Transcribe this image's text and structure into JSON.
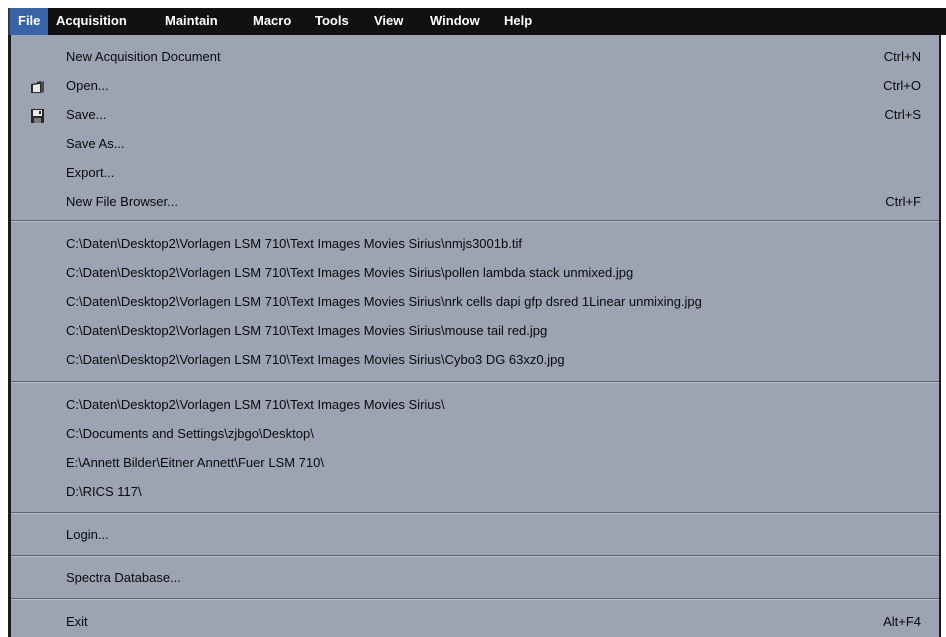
{
  "menubar": {
    "items": [
      {
        "label": "File"
      },
      {
        "label": "Acquisition"
      },
      {
        "label": "Maintain"
      },
      {
        "label": "Macro"
      },
      {
        "label": "Tools"
      },
      {
        "label": "View"
      },
      {
        "label": "Window"
      },
      {
        "label": "Help"
      }
    ]
  },
  "file_menu": {
    "new_acquisition": {
      "label": "New Acquisition Document",
      "shortcut": "Ctrl+N"
    },
    "open": {
      "label": "Open...",
      "shortcut": "Ctrl+O",
      "icon": "open-folder-icon"
    },
    "save": {
      "label": "Save...",
      "shortcut": "Ctrl+S",
      "icon": "floppy-disk-icon"
    },
    "save_as": {
      "label": "Save As..."
    },
    "export": {
      "label": "Export..."
    },
    "new_file_browser": {
      "label": "New File Browser...",
      "shortcut": "Ctrl+F"
    },
    "recent_files": [
      {
        "label": "C:\\Daten\\Desktop2\\Vorlagen LSM 710\\Text Images Movies Sirius\\nmjs3001b.tif"
      },
      {
        "label": "C:\\Daten\\Desktop2\\Vorlagen LSM 710\\Text Images Movies Sirius\\pollen lambda stack unmixed.jpg"
      },
      {
        "label": "C:\\Daten\\Desktop2\\Vorlagen LSM 710\\Text Images Movies Sirius\\nrk cells dapi gfp dsred 1Linear unmixing.jpg"
      },
      {
        "label": "C:\\Daten\\Desktop2\\Vorlagen LSM 710\\Text Images Movies Sirius\\mouse tail red.jpg"
      },
      {
        "label": "C:\\Daten\\Desktop2\\Vorlagen LSM 710\\Text Images Movies Sirius\\Cybo3 DG 63xz0.jpg"
      }
    ],
    "recent_folders": [
      {
        "label": "C:\\Daten\\Desktop2\\Vorlagen LSM 710\\Text Images Movies Sirius\\"
      },
      {
        "label": "C:\\Documents and Settings\\zjbgo\\Desktop\\"
      },
      {
        "label": "E:\\Annett Bilder\\Eitner Annett\\Fuer LSM 710\\"
      },
      {
        "label": "D:\\RICS 117\\"
      }
    ],
    "login": {
      "label": "Login..."
    },
    "spectra_database": {
      "label": "Spectra Database..."
    },
    "exit": {
      "label": "Exit",
      "shortcut": "Alt+F4"
    }
  },
  "colors": {
    "menubar_bg": "#111111",
    "active_menu_bg": "#3a63a6",
    "dropdown_bg": "#9ca3b2"
  }
}
